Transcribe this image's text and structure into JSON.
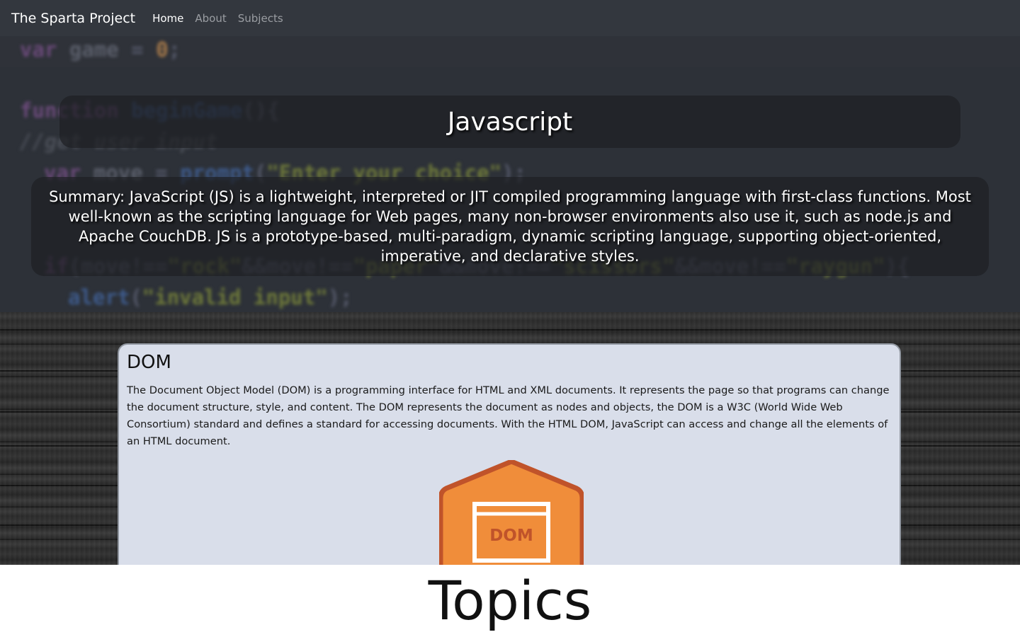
{
  "navbar": {
    "brand": "The Sparta Project",
    "links": [
      {
        "label": "Home",
        "active": true
      },
      {
        "label": "About",
        "active": false
      },
      {
        "label": "Subjects",
        "active": false
      }
    ]
  },
  "hero": {
    "title": "Javascript",
    "summary": "Summary: JavaScript (JS) is a lightweight, interpreted or JIT compiled programming language with first-class functions. Most well-known as the scripting language for Web pages, many non-browser environments also use it, such as node.js and Apache CouchDB. JS is a prototype-based, multi-paradigm, dynamic scripting language, supporting object-oriented, imperative, and declarative styles.",
    "background_code": [
      "var game = 0;",
      "function beginGame(){",
      "//get user input",
      "  var move = prompt(\"Enter your choice\");",
      "if(move!==\"rock\"&&move!==\"paper\"&&move!==\"scissors\"&&move!==\"raygun\"){",
      "  alert(\"invalid input\");"
    ]
  },
  "topic_card": {
    "title": "DOM",
    "description": "The Document Object Model (DOM) is a programming interface for HTML and XML documents. It represents the page so that programs can change the document structure, style, and content. The DOM represents the document as nodes and objects, the DOM is a W3C (World Wide Web Consortium) standard and defines a standard for accessing documents. With the HTML DOM, JavaScript can access and change all the elements of an HTML document.",
    "logo_text": "DOM"
  },
  "topics_heading": "Topics",
  "colors": {
    "navbar_bg": "#33373e",
    "hero_bg": "#2d3138",
    "card_bg": "#d9deea",
    "logo_orange": "#f08d3a",
    "logo_border": "#c0532a"
  }
}
